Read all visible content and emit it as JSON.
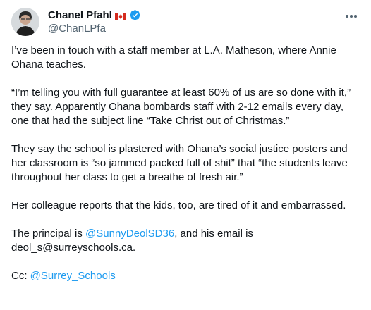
{
  "author": {
    "display_name": "Chanel Pfahl",
    "handle": "@ChanLPfa",
    "flag": "canada-flag-icon",
    "verified": true
  },
  "tweet": {
    "p1": "I’ve been in touch with a staff member at L.A. Matheson, where Annie Ohana teaches.",
    "p2": "“I’m telling you with full guarantee at least 60% of us are so done with it,” they say. Apparently Ohana bombards staff with 2-12 emails every day, one that had the subject line “Take Christ out of Christmas.”",
    "p3": "They say the school is plastered with Ohana’s social justice posters and her classroom is “so jammed packed full of shit” that “the students leave throughout her class to get a breathe of fresh air.”",
    "p4": "Her colleague reports that the kids, too, are tired of it and embarrassed.",
    "p5_prefix": "The principal is ",
    "p5_mention": "@SunnyDeolSD36",
    "p5_suffix": ", and his email is deol_s@surreyschools.ca.",
    "p6_prefix": "Cc: ",
    "p6_mention": "@Surrey_Schools"
  },
  "colors": {
    "link": "#1d9bf0",
    "text": "#0f1419",
    "secondary": "#536471",
    "verified": "#1d9bf0"
  }
}
